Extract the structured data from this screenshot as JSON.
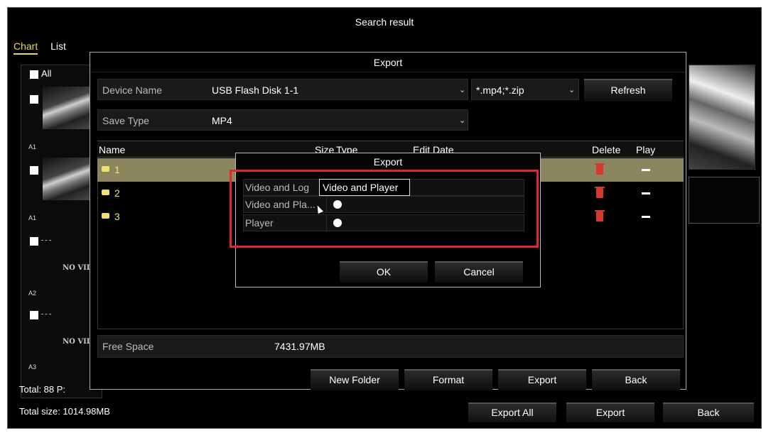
{
  "window": {
    "title": "Search result"
  },
  "tabs": [
    {
      "label": "Chart"
    },
    {
      "label": "List"
    }
  ],
  "left_panel": {
    "all_label": "All",
    "cams": [
      "A1",
      "A1",
      "A2",
      "A3"
    ],
    "no_video": "NO VID"
  },
  "footer": {
    "total": "Total: 88  P:",
    "total_size": "Total size: 1014.98MB",
    "export_all": "Export All",
    "export": "Export",
    "back": "Back"
  },
  "export_dialog": {
    "title": "Export",
    "device_name_label": "Device Name",
    "device_name_value": "USB Flash Disk 1-1",
    "filter_value": "*.mp4;*.zip",
    "refresh": "Refresh",
    "save_type_label": "Save Type",
    "save_type_value": "MP4",
    "columns": {
      "name": "Name",
      "size": "Size",
      "type": "Type",
      "edit_date": "Edit Date",
      "delete": "Delete",
      "play": "Play"
    },
    "rows": [
      {
        "name": "1"
      },
      {
        "name": "2"
      },
      {
        "name": "3"
      }
    ],
    "free_space_label": "Free Space",
    "free_space_value": "7431.97MB",
    "buttons": {
      "new_folder": "New Folder",
      "format": "Format",
      "export": "Export",
      "back": "Back"
    }
  },
  "popup": {
    "title": "Export",
    "options": [
      {
        "label": "Video and Log"
      },
      {
        "label": "Video and Pla..."
      },
      {
        "label": "Player"
      }
    ],
    "tooltip": "Video and Player",
    "ok": "OK",
    "cancel": "Cancel"
  },
  "colors": {
    "highlight": "#e0262e",
    "selected_row": "#8c8660",
    "active_tab": "#e9d65c"
  }
}
